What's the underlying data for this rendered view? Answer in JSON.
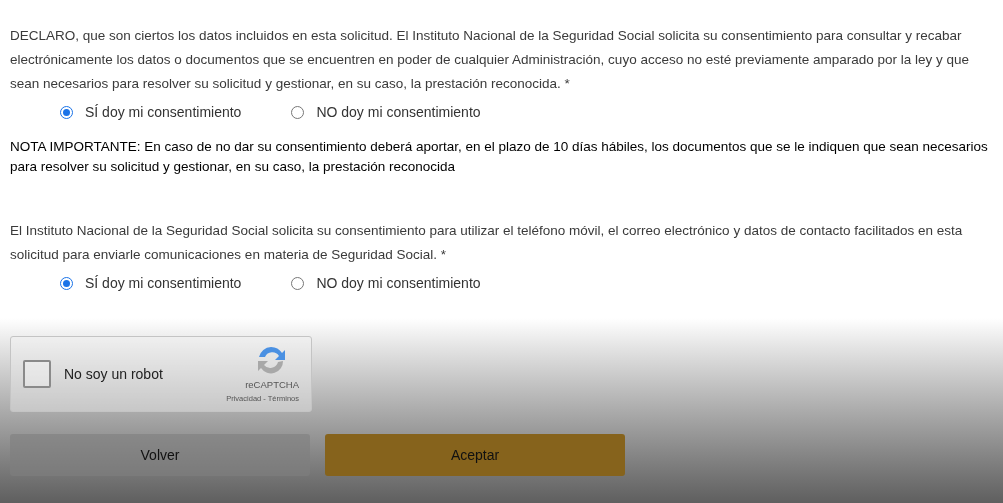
{
  "consents": [
    {
      "text": "DECLARO, que son ciertos los datos incluidos en esta solicitud. El Instituto Nacional de la Seguridad Social solicita su consentimiento para consultar y recabar electrónicamente los datos o documentos que se encuentren en poder de cualquier Administración, cuyo acceso no esté previamente amparado por la ley y que sean necesarios para resolver su solicitud y gestionar, en su caso, la prestación reconocida. *",
      "options": [
        {
          "label": "SÍ doy mi consentimiento",
          "selected": true
        },
        {
          "label": "NO doy mi consentimiento",
          "selected": false
        }
      ],
      "note": "NOTA IMPORTANTE: En caso de no dar su consentimiento deberá aportar, en el plazo de 10 días hábiles, los documentos que se le indiquen que sean necesarios para resolver su solicitud y gestionar, en su caso, la prestación reconocida"
    },
    {
      "text": "El Instituto Nacional de la Seguridad Social solicita su consentimiento para utilizar el teléfono móvil, el correo electrónico y datos de contacto facilitados en esta solicitud para enviarle comunicaciones en materia de Seguridad Social. *",
      "options": [
        {
          "label": "SÍ doy mi consentimiento",
          "selected": true
        },
        {
          "label": "NO doy mi consentimiento",
          "selected": false
        }
      ]
    }
  ],
  "captcha": {
    "label": "No soy un robot",
    "checked": false,
    "brand": "reCAPTCHA",
    "privacy": "Privacidad",
    "separator": "-",
    "terms": "Términos"
  },
  "buttons": [
    {
      "label": "Volver",
      "kind": "secondary"
    },
    {
      "label": "Aceptar",
      "kind": "primary"
    }
  ]
}
